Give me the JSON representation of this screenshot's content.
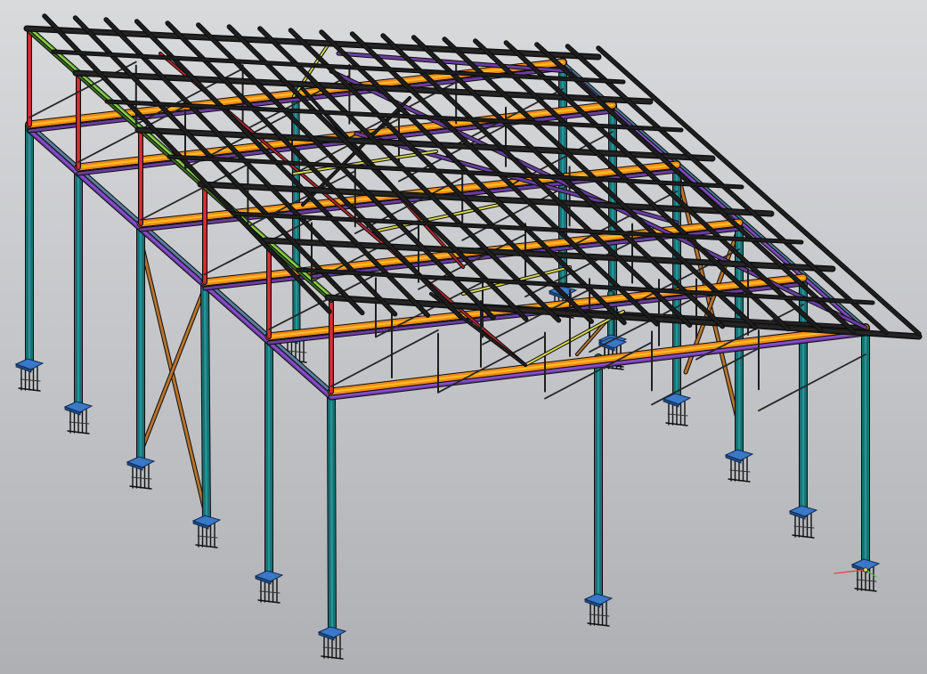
{
  "viewport": {
    "background_top": "#d9dadc",
    "background_bottom": "#aeb0b3"
  },
  "model": {
    "member_colors": {
      "columns": "#1a6f72",
      "eave_beams": "#f08c1a",
      "transverse_girders": "#f08c1a",
      "longitudinal_ties": "#6a3da0",
      "purlins": "#1e1e1e",
      "truss_web": "#2a2a2a",
      "red_braces": "#b3262d",
      "yellow_braces": "#d8d84a",
      "green_rafter": "#6da83a",
      "wall_braces": "#b8742c",
      "base_plates": "#3a78c8",
      "anchor_bolts": "#111111"
    },
    "triad_icon": "coordinate-axes-icon"
  }
}
